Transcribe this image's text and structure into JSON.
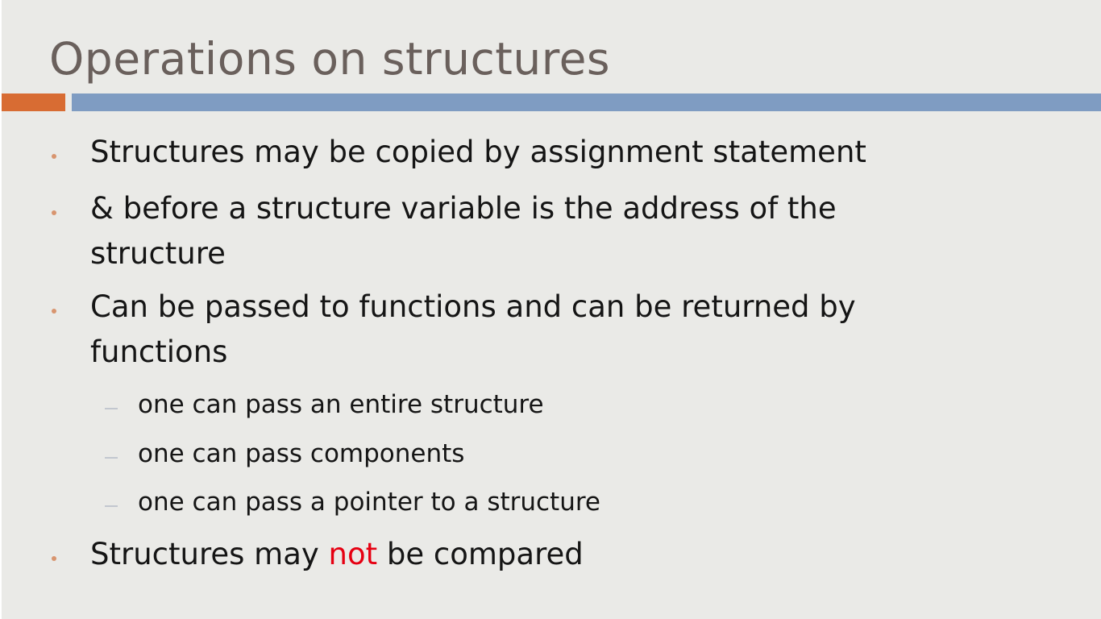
{
  "slide": {
    "title": "Operations on structures",
    "bullets": [
      {
        "text": "Structures may be copied by assignment statement"
      },
      {
        "line1": "& before a structure variable is  the address of the",
        "line2": "structure"
      },
      {
        "line1": "Can be passed to functions and can be returned by",
        "line2": "functions"
      },
      {
        "before": "Structures may ",
        "highlight": "not",
        "after": " be compared"
      }
    ],
    "sub_bullets": [
      "one can pass an entire structure",
      "one can pass components",
      "one can pass a pointer to a structure"
    ],
    "colors": {
      "title": "#6a605c",
      "accent_orange": "#d86c33",
      "accent_blue": "#7f9cc2",
      "highlight_red": "#e60012",
      "background": "#eaeae7"
    }
  }
}
